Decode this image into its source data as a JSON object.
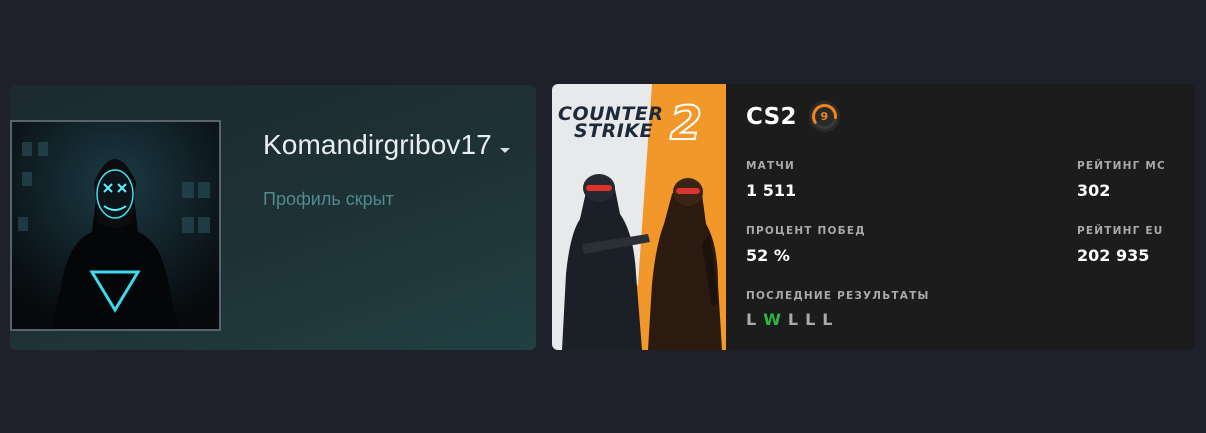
{
  "profile": {
    "username": "Komandirgribov17",
    "status_text": "Профиль скрыт",
    "status_color": "#4f8a8f"
  },
  "game": {
    "cover_logo_line1": "COUNTER",
    "cover_logo_line2": "STRIKE",
    "cover_logo_number": "2",
    "title": "CS2",
    "level": "9",
    "level_color": "#f2851a",
    "stats": {
      "matches_label": "Матчи",
      "matches_value": "1 511",
      "mc_rating_label": "Рейтинг MC",
      "mc_rating_value": "302",
      "win_rate_label": "Процент побед",
      "win_rate_value": "52 %",
      "eu_rating_label": "Рейтинг EU",
      "eu_rating_value": "202 935",
      "recent_results_label": "Последние результаты"
    },
    "recent_results": [
      "L",
      "W",
      "L",
      "L",
      "L"
    ],
    "result_colors": {
      "W": "#32b343",
      "L": "#a8aaac"
    }
  },
  "colors": {
    "page_background": "#1e2129",
    "game_card_background": "#1c1c1d",
    "cover_orange": "#f2972a"
  }
}
